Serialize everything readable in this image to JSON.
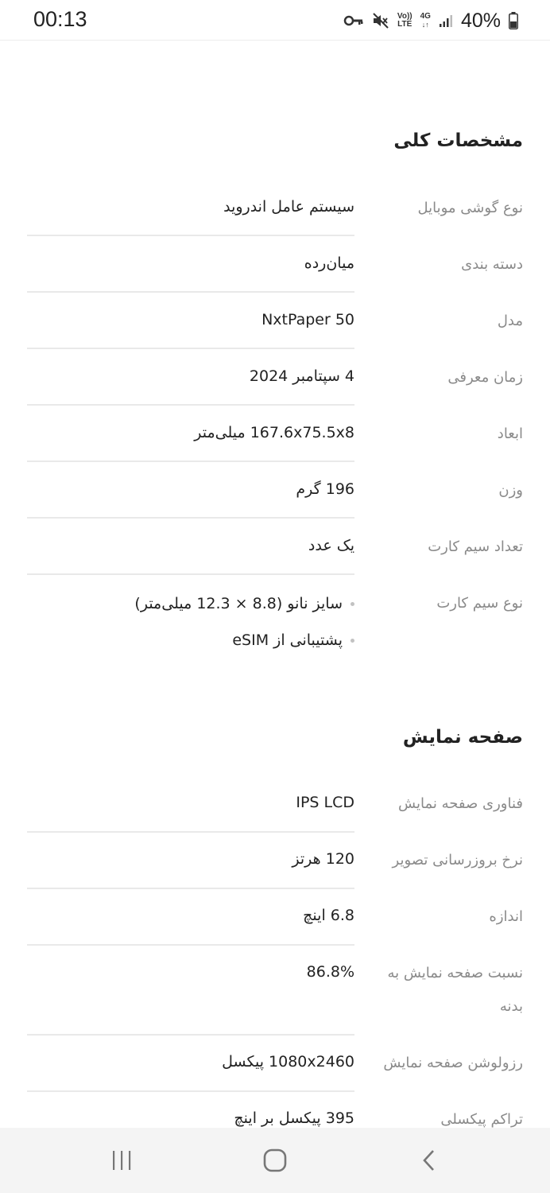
{
  "status_bar": {
    "time": "00:13",
    "battery": "40%",
    "network_type": "4G",
    "volte_line1": "Vo))",
    "volte_line2": "LTE",
    "icons": [
      "vpn-key-icon",
      "mute-icon",
      "volte-icon",
      "4g-icon",
      "signal-icon",
      "battery-icon"
    ]
  },
  "sections": [
    {
      "title": "مشخصات کلی",
      "rows": [
        {
          "label": "نوع گوشی موبایل",
          "value": "سیستم عامل اندروید"
        },
        {
          "label": "دسته بندی",
          "value": "میان‌رده"
        },
        {
          "label": "مدل",
          "value": "NxtPaper 50"
        },
        {
          "label": "زمان معرفی",
          "value": "4 سپتامبر 2024"
        },
        {
          "label": "ابعاد",
          "value": "167.6x75.5x8 میلی‌متر"
        },
        {
          "label": "وزن",
          "value": "196 گرم"
        },
        {
          "label": "تعداد سیم کارت",
          "value": "یک عدد"
        },
        {
          "label": "نوع سیم کارت",
          "values": [
            "سایز نانو (8.8 × 12.3 میلی‌متر)",
            "پشتیبانی از eSIM"
          ]
        }
      ]
    },
    {
      "title": "صفحه نمایش",
      "rows": [
        {
          "label": "فناوری صفحه نمایش",
          "value": "IPS LCD"
        },
        {
          "label": "نرخ بروزرسانی تصویر",
          "value": "120 هرتز"
        },
        {
          "label": "اندازه",
          "value": "6.8 اینچ"
        },
        {
          "label": "نسبت صفحه نمایش به بدنه",
          "value": "86.8%"
        },
        {
          "label": "رزولوشن صفحه نمایش",
          "value": "1080x2460 پیکسل"
        },
        {
          "label": "تراکم پیکسلی",
          "value": "395 پیکسل بر اینچ"
        }
      ]
    }
  ],
  "nav_bar": {
    "icons": [
      "recent-apps-icon",
      "home-icon",
      "back-icon"
    ]
  }
}
